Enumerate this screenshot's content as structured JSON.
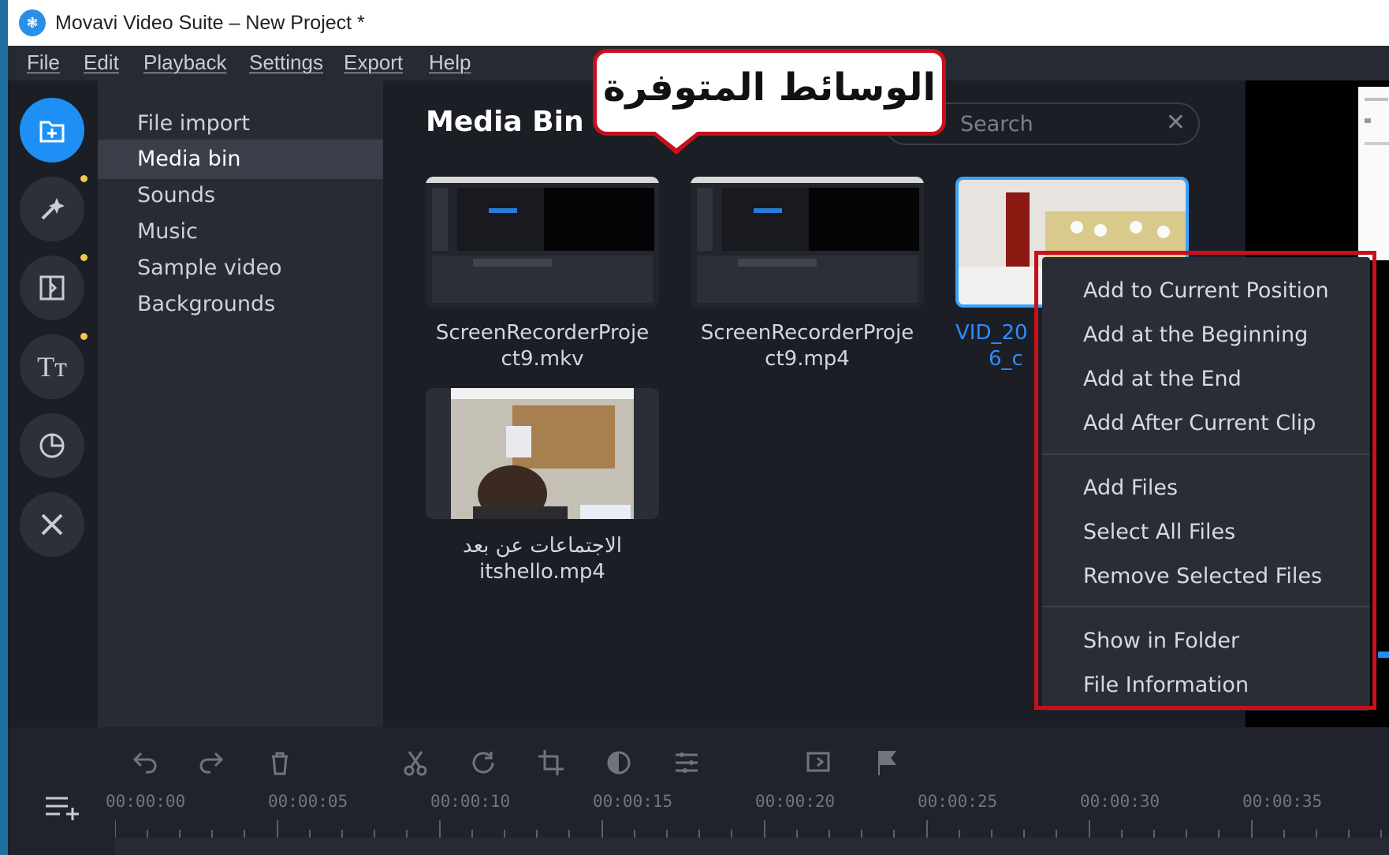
{
  "window": {
    "title": "Movavi Video Suite – New Project *"
  },
  "menu": [
    "File",
    "Edit",
    "Playback",
    "Settings",
    "Export",
    "Help"
  ],
  "sidebar_icons": [
    "import-icon",
    "magic-wand-icon",
    "transitions-icon",
    "titles-icon",
    "stickers-icon",
    "tools-icon"
  ],
  "categories": [
    "File import",
    "Media bin",
    "Sounds",
    "Music",
    "Sample video",
    "Backgrounds"
  ],
  "selected_category": "Media bin",
  "media_bin": {
    "title": "Media Bin",
    "search_placeholder": "Search",
    "files": [
      {
        "line1": "ScreenRecorderProje",
        "line2": "ct9.mkv"
      },
      {
        "line1": "ScreenRecorderProje",
        "line2": "ct9.mp4"
      },
      {
        "line1": "VID_20",
        "line2": "6_c"
      },
      {
        "line1": "الاجتماعات عن بعد",
        "line2": "itshello.mp4"
      }
    ]
  },
  "callout": {
    "text": "الوسائط المتوفرة"
  },
  "context_menu": {
    "group1": [
      "Add to Current Position",
      "Add at the Beginning",
      "Add at the End",
      "Add After Current Clip"
    ],
    "group2": [
      "Add Files",
      "Select All Files",
      "Remove Selected Files"
    ],
    "group3": [
      "Show in Folder",
      "File Information"
    ]
  },
  "timeline": {
    "tools": [
      "undo-icon",
      "redo-icon",
      "delete-icon",
      "cut-icon",
      "rotate-icon",
      "crop-icon",
      "color-adjust-icon",
      "clip-properties-icon",
      "transition-wizard-icon",
      "marker-flag-icon"
    ],
    "time_labels": [
      "00:00:00",
      "00:00:05",
      "00:00:10",
      "00:00:15",
      "00:00:20",
      "00:00:25",
      "00:00:30",
      "00:00:35"
    ]
  },
  "colors": {
    "accent": "#1e90f5",
    "highlight_red": "#c8101c",
    "selected_file": "#2f8cff"
  }
}
